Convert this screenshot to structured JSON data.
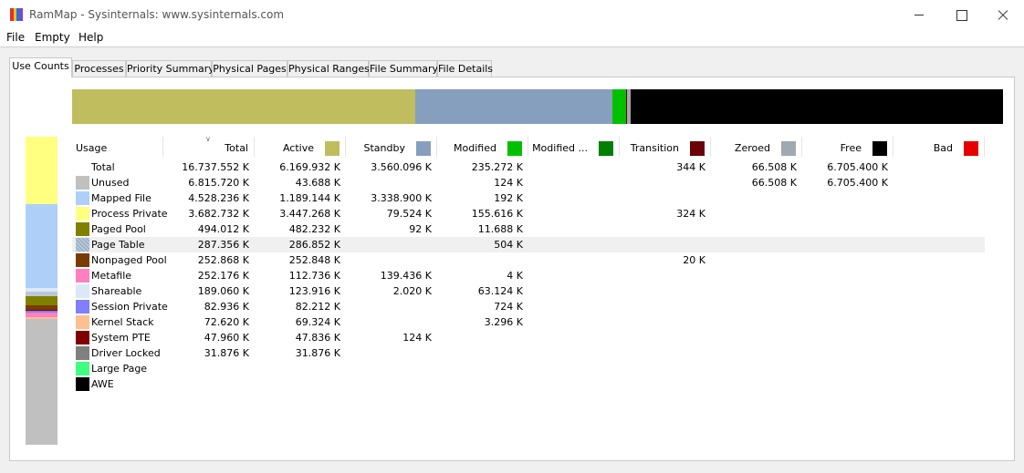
{
  "window": {
    "title": "RamMap - Sysinternals: www.sysinternals.com",
    "icon_colors": [
      "#e62e2e",
      "#f0c020",
      "#2f6fd6",
      "#8a3fc9"
    ]
  },
  "menu": [
    "File",
    "Empty",
    "Help"
  ],
  "tabs": [
    "Use Counts",
    "Processes",
    "Priority Summary",
    "Physical Pages",
    "Physical Ranges",
    "File Summary",
    "File Details"
  ],
  "active_tab": 0,
  "columns": [
    {
      "label": "Usage",
      "color": null
    },
    {
      "label": "Total",
      "color": null
    },
    {
      "label": "Active",
      "color": "#bfbd5e"
    },
    {
      "label": "Standby",
      "color": "#879fbe"
    },
    {
      "label": "Modified",
      "color": "#00c000"
    },
    {
      "label": "Modified ...",
      "color": "#007f00"
    },
    {
      "label": "Transition",
      "color": "#6b0008"
    },
    {
      "label": "Zeroed",
      "color": "#a0a8b0"
    },
    {
      "label": "Free",
      "color": "#000000"
    },
    {
      "label": "Bad",
      "color": "#e80000"
    }
  ],
  "rows": [
    {
      "name": "Total",
      "color": null,
      "values": [
        "16.737.552 K",
        "6.169.932 K",
        "3.560.096 K",
        "235.272 K",
        "",
        "344 K",
        "66.508 K",
        "6.705.400 K",
        ""
      ]
    },
    {
      "name": "Unused",
      "color": "#c0c0c0",
      "values": [
        "6.815.720 K",
        "43.688 K",
        "",
        "124 K",
        "",
        "",
        "66.508 K",
        "6.705.400 K",
        ""
      ]
    },
    {
      "name": "Mapped File",
      "color": "#aed0f8",
      "values": [
        "4.528.236 K",
        "1.189.144 K",
        "3.338.900 K",
        "192 K",
        "",
        "",
        "",
        "",
        ""
      ]
    },
    {
      "name": "Process Private",
      "color": "#ffff80",
      "values": [
        "3.682.732 K",
        "3.447.268 K",
        "79.524 K",
        "155.616 K",
        "",
        "324 K",
        "",
        "",
        ""
      ]
    },
    {
      "name": "Paged Pool",
      "color": "#808000",
      "values": [
        "494.012 K",
        "482.232 K",
        "92 K",
        "11.688 K",
        "",
        "",
        "",
        "",
        ""
      ]
    },
    {
      "name": "Page Table",
      "color": "#b8c8d8",
      "values": [
        "287.356 K",
        "286.852 K",
        "",
        "504 K",
        "",
        "",
        "",
        "",
        ""
      ],
      "highlight": true
    },
    {
      "name": "Nonpaged Pool",
      "color": "#7a3b00",
      "values": [
        "252.868 K",
        "252.848 K",
        "",
        "",
        "",
        "20 K",
        "",
        "",
        ""
      ]
    },
    {
      "name": "Metafile",
      "color": "#ff80c0",
      "values": [
        "252.176 K",
        "112.736 K",
        "139.436 K",
        "4 K",
        "",
        "",
        "",
        "",
        ""
      ]
    },
    {
      "name": "Shareable",
      "color": "#dbe8f8",
      "values": [
        "189.060 K",
        "123.916 K",
        "2.020 K",
        "63.124 K",
        "",
        "",
        "",
        "",
        ""
      ]
    },
    {
      "name": "Session Private",
      "color": "#8080ff",
      "values": [
        "82.936 K",
        "82.212 K",
        "",
        "724 K",
        "",
        "",
        "",
        "",
        ""
      ]
    },
    {
      "name": "Kernel Stack",
      "color": "#ffc090",
      "values": [
        "72.620 K",
        "69.324 K",
        "",
        "3.296 K",
        "",
        "",
        "",
        "",
        ""
      ]
    },
    {
      "name": "System PTE",
      "color": "#800000",
      "values": [
        "47.960 K",
        "47.836 K",
        "124 K",
        "",
        "",
        "",
        "",
        "",
        ""
      ]
    },
    {
      "name": "Driver Locked",
      "color": "#808080",
      "values": [
        "31.876 K",
        "31.876 K",
        "",
        "",
        "",
        "",
        "",
        "",
        ""
      ]
    },
    {
      "name": "Large Page",
      "color": "#40ff80",
      "values": [
        "",
        "",
        "",
        "",
        "",
        "",
        "",
        "",
        ""
      ]
    },
    {
      "name": "AWE",
      "color": "#000000",
      "values": [
        "",
        "",
        "",
        "",
        "",
        "",
        "",
        "",
        ""
      ]
    }
  ],
  "summary_bar": {
    "total_k": 16737552,
    "segments": [
      {
        "label": "Active",
        "value_k": 6169932,
        "color": "#bfbd5e"
      },
      {
        "label": "Standby",
        "value_k": 3560096,
        "color": "#879fbe"
      },
      {
        "label": "Modified",
        "value_k": 235272,
        "color": "#00c000"
      },
      {
        "label": "Transition",
        "value_k": 344,
        "color": "#6b0008"
      },
      {
        "label": "Zeroed",
        "value_k": 66508,
        "color": "#a0a8b0"
      },
      {
        "label": "Free",
        "value_k": 6705400,
        "color": "#000000"
      }
    ]
  },
  "usage_bar": {
    "total_k": 16737552,
    "segments": [
      {
        "label": "Process Private",
        "value_k": 3682732,
        "color": "#ffff80"
      },
      {
        "label": "Mapped File",
        "value_k": 4528236,
        "color": "#aed0f8"
      },
      {
        "label": "Shareable",
        "value_k": 189060,
        "color": "#dbe8f8"
      },
      {
        "label": "Page Table",
        "value_k": 287356,
        "color": "#b8c8d8"
      },
      {
        "label": "Paged Pool",
        "value_k": 494012,
        "color": "#808000"
      },
      {
        "label": "Nonpaged Pool",
        "value_k": 252868,
        "color": "#7a3b00"
      },
      {
        "label": "System PTE",
        "value_k": 47960,
        "color": "#800000"
      },
      {
        "label": "Session Private",
        "value_k": 82936,
        "color": "#8080ff"
      },
      {
        "label": "Metafile",
        "value_k": 252176,
        "color": "#ff80c0"
      },
      {
        "label": "Kernel Stack",
        "value_k": 72620,
        "color": "#ffc090"
      },
      {
        "label": "Driver Locked",
        "value_k": 31876,
        "color": "#808080"
      },
      {
        "label": "Unused",
        "value_k": 6815720,
        "color": "#c0c0c0"
      }
    ]
  }
}
